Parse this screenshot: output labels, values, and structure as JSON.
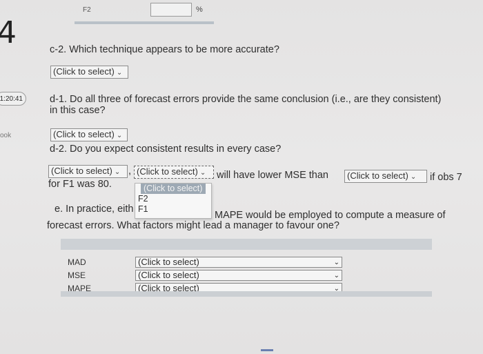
{
  "top": {
    "label_f2": "F2",
    "mark": "%"
  },
  "side": {
    "number": "4",
    "timer": "1:20:41",
    "ook": "ook"
  },
  "c2": {
    "question": "c-2. Which technique appears to be more accurate?",
    "select": "(Click to select)"
  },
  "d1": {
    "line1": "d-1. Do all three of forecast errors provide the same conclusion (i.e., are they consistent)",
    "line2": "in this case?",
    "select": "(Click to select)"
  },
  "d2": {
    "question": "d-2. Do you expect consistent results in every case?",
    "select1": "(Click to select)",
    "comma": ",",
    "select2": "(Click to select)",
    "mid_text": "will have lower MSE than",
    "select3": "(Click to select)",
    "tail": "if obs 7",
    "line2": "for F1 was 80."
  },
  "dropdown": {
    "options": [
      "(Click to select)",
      "F2",
      "F1"
    ]
  },
  "e": {
    "line1a": "e. In practice, eith",
    "line1b": "MAPE would be employed to compute a measure of",
    "line2": "forecast errors. What factors might lead a manager to favour one?"
  },
  "table": {
    "rows": [
      {
        "label": "MAD",
        "select": "(Click to select)"
      },
      {
        "label": "MSE",
        "select": "(Click to select)"
      },
      {
        "label": "MAPE",
        "select": "(Click to select)"
      }
    ]
  },
  "icons": {
    "chevron": "⌄"
  }
}
